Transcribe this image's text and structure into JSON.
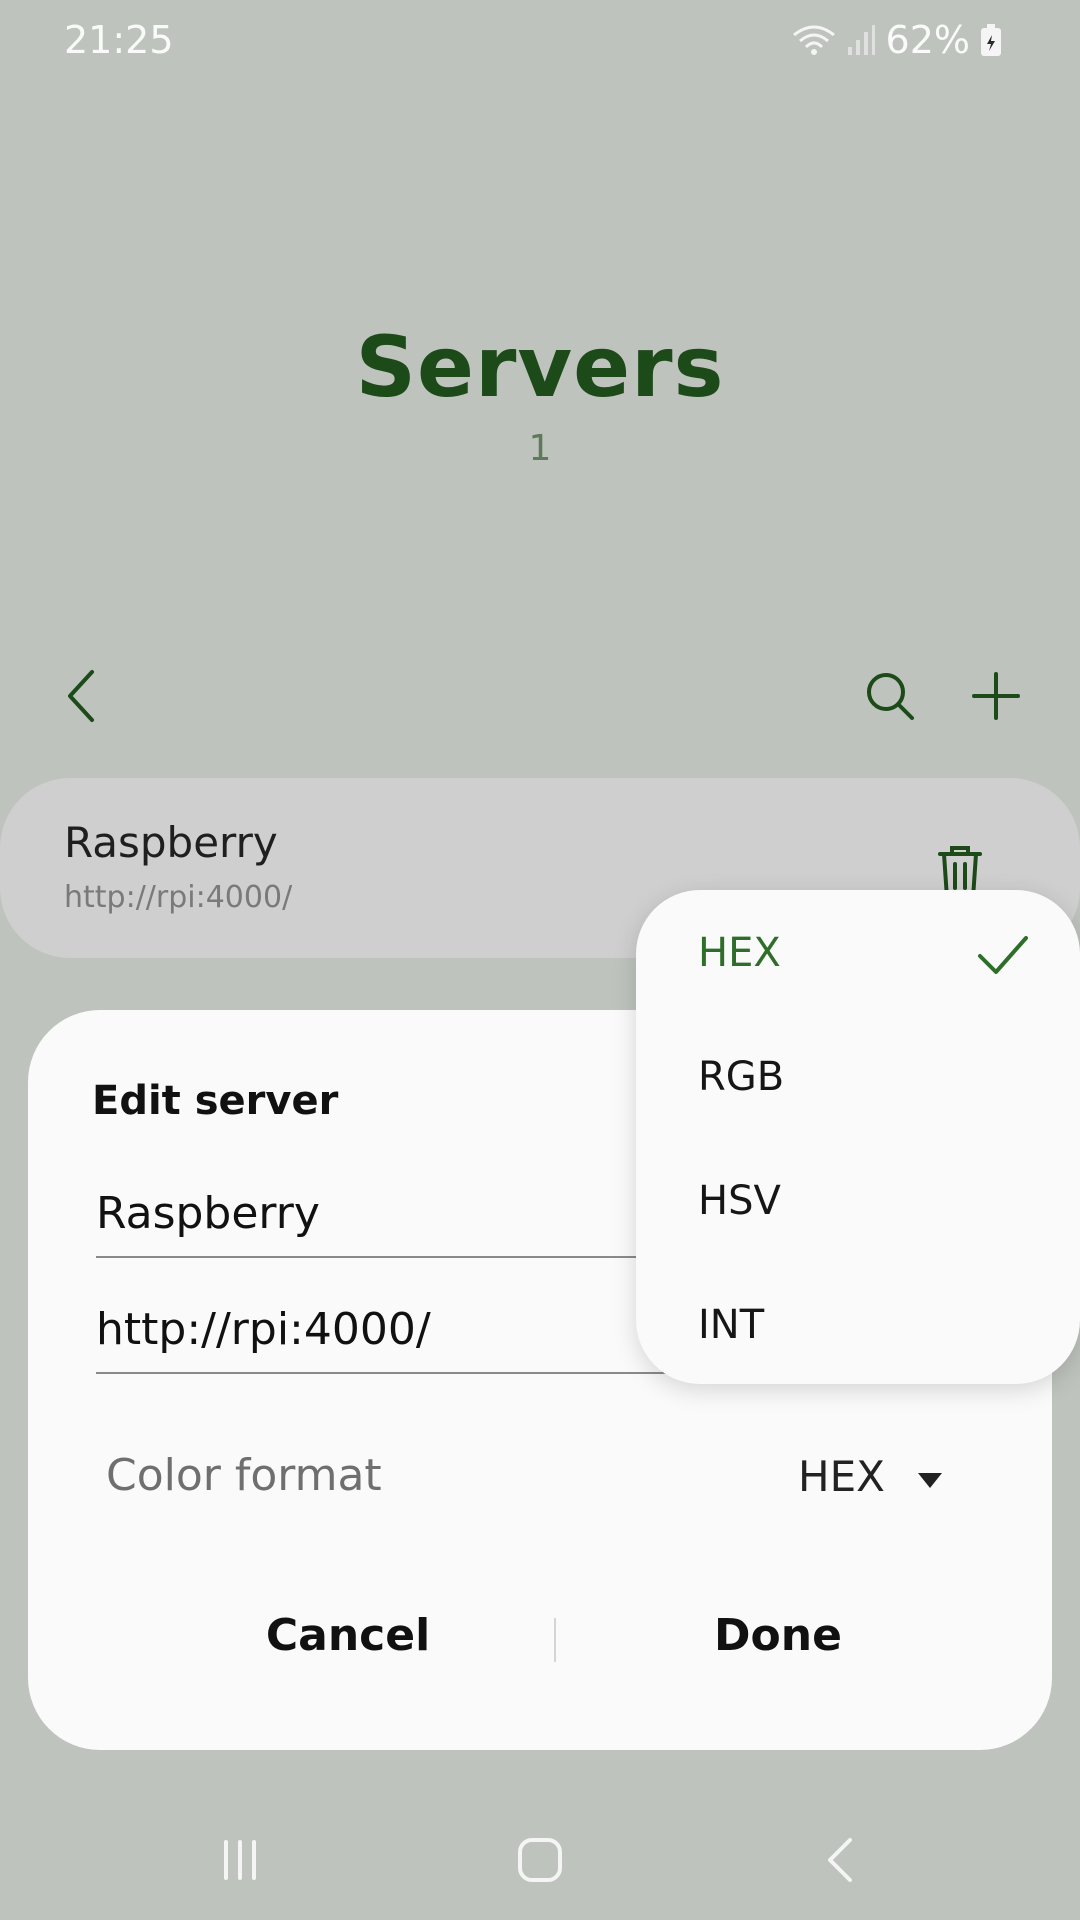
{
  "status_bar": {
    "time": "21:25",
    "battery": "62%",
    "icons": [
      "wifi-icon",
      "signal-icon",
      "battery-icon"
    ]
  },
  "header": {
    "title": "Servers",
    "count": "1"
  },
  "toolbar": {
    "icons": [
      "back-arrow-icon",
      "search-icon",
      "plus-icon"
    ]
  },
  "server": {
    "name": "Raspberry",
    "url": "http://rpi:4000/",
    "icon": "trash-icon"
  },
  "dialog": {
    "title": "Edit server",
    "name_value": "Raspberry",
    "url_value": "http://rpi:4000/",
    "color_format_label": "Color format",
    "color_format_value": "HEX",
    "cancel_label": "Cancel",
    "done_label": "Done"
  },
  "dropdown": {
    "options": [
      "HEX",
      "RGB",
      "HSV",
      "INT"
    ],
    "selected": "HEX"
  },
  "navigation": {
    "icons": [
      "recents-icon",
      "home-icon",
      "back-icon"
    ]
  },
  "colors": {
    "accent": "#1c4a18",
    "selected_option": "#2f6e2a",
    "background": "#bec3bd",
    "dialog_background": "#fafafa"
  }
}
